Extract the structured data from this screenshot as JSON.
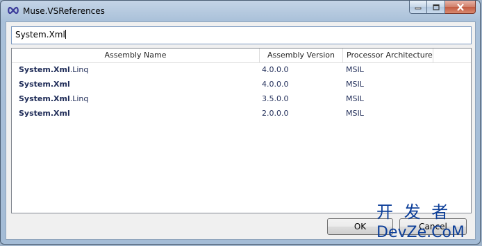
{
  "window": {
    "title": "Muse.VSReferences",
    "icon": "infinity-icon"
  },
  "caption_buttons": {
    "minimize": "minimize-icon",
    "maximize": "maximize-icon",
    "close": "close-icon"
  },
  "search": {
    "value": "System.Xml"
  },
  "list": {
    "columns": [
      "Assembly Name",
      "Assembly Version",
      "Processor Architecture"
    ],
    "rows": [
      {
        "name_match": "System.Xml",
        "name_rest": ".Linq",
        "version": "4.0.0.0",
        "arch": "MSIL"
      },
      {
        "name_match": "System.Xml",
        "name_rest": "",
        "version": "4.0.0.0",
        "arch": "MSIL"
      },
      {
        "name_match": "System.Xml",
        "name_rest": ".Linq",
        "version": "3.5.0.0",
        "arch": "MSIL"
      },
      {
        "name_match": "System.Xml",
        "name_rest": "",
        "version": "2.0.0.0",
        "arch": "MSIL"
      }
    ]
  },
  "buttons": {
    "ok": "OK",
    "cancel": "Cancel"
  },
  "watermark": {
    "line1": "开 发 者",
    "line2": "DevZe.CoM"
  }
}
